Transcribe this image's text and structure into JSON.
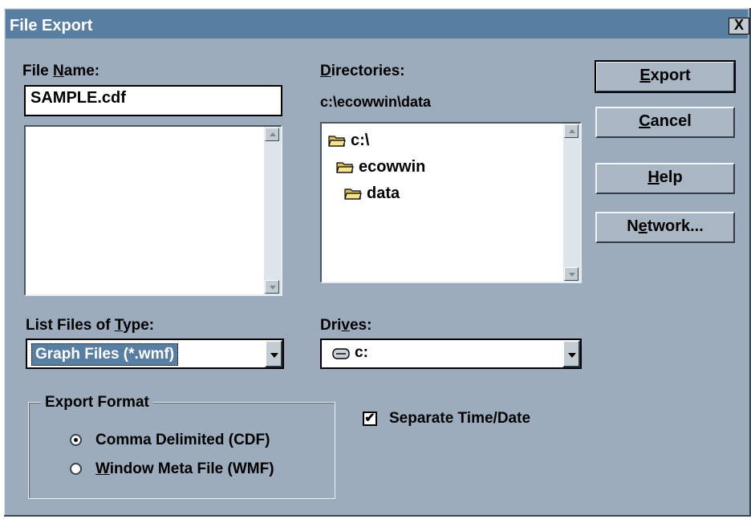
{
  "window": {
    "title": "File Export",
    "close_glyph": "X"
  },
  "file_name": {
    "label_pre": "File ",
    "label_ul": "N",
    "label_post": "ame:",
    "value": "SAMPLE.cdf"
  },
  "directories": {
    "label_ul": "D",
    "label_post": "irectories:",
    "current_path": "c:\\ecowwin\\data",
    "items": [
      {
        "label": "c:\\",
        "icon": "open-folder-icon"
      },
      {
        "label": "ecowwin",
        "icon": "open-folder-icon"
      },
      {
        "label": "data",
        "icon": "open-folder-icon"
      }
    ]
  },
  "buttons": {
    "export_ul": "E",
    "export_rest": "xport",
    "cancel_ul": "C",
    "cancel_rest": "ancel",
    "help_ul": "H",
    "help_rest": "elp",
    "network_pre": "N",
    "network_ul": "e",
    "network_rest": "twork..."
  },
  "file_type": {
    "label_pre": "List Files of ",
    "label_ul": "T",
    "label_post": "ype:",
    "selected": "Graph Files (*.wmf)"
  },
  "drives": {
    "label_pre": "Dri",
    "label_ul": "v",
    "label_post": "es:",
    "selected": "c:",
    "icon": "drive-icon"
  },
  "export_format": {
    "legend": "Export Format",
    "options": [
      {
        "label": "Comma Delimited (CDF)",
        "checked": true
      },
      {
        "label_ul": "W",
        "label_rest": "indow Meta File (WMF)",
        "checked": false
      }
    ]
  },
  "separate_time": {
    "label": "Separate Time/Date",
    "checked": true
  }
}
